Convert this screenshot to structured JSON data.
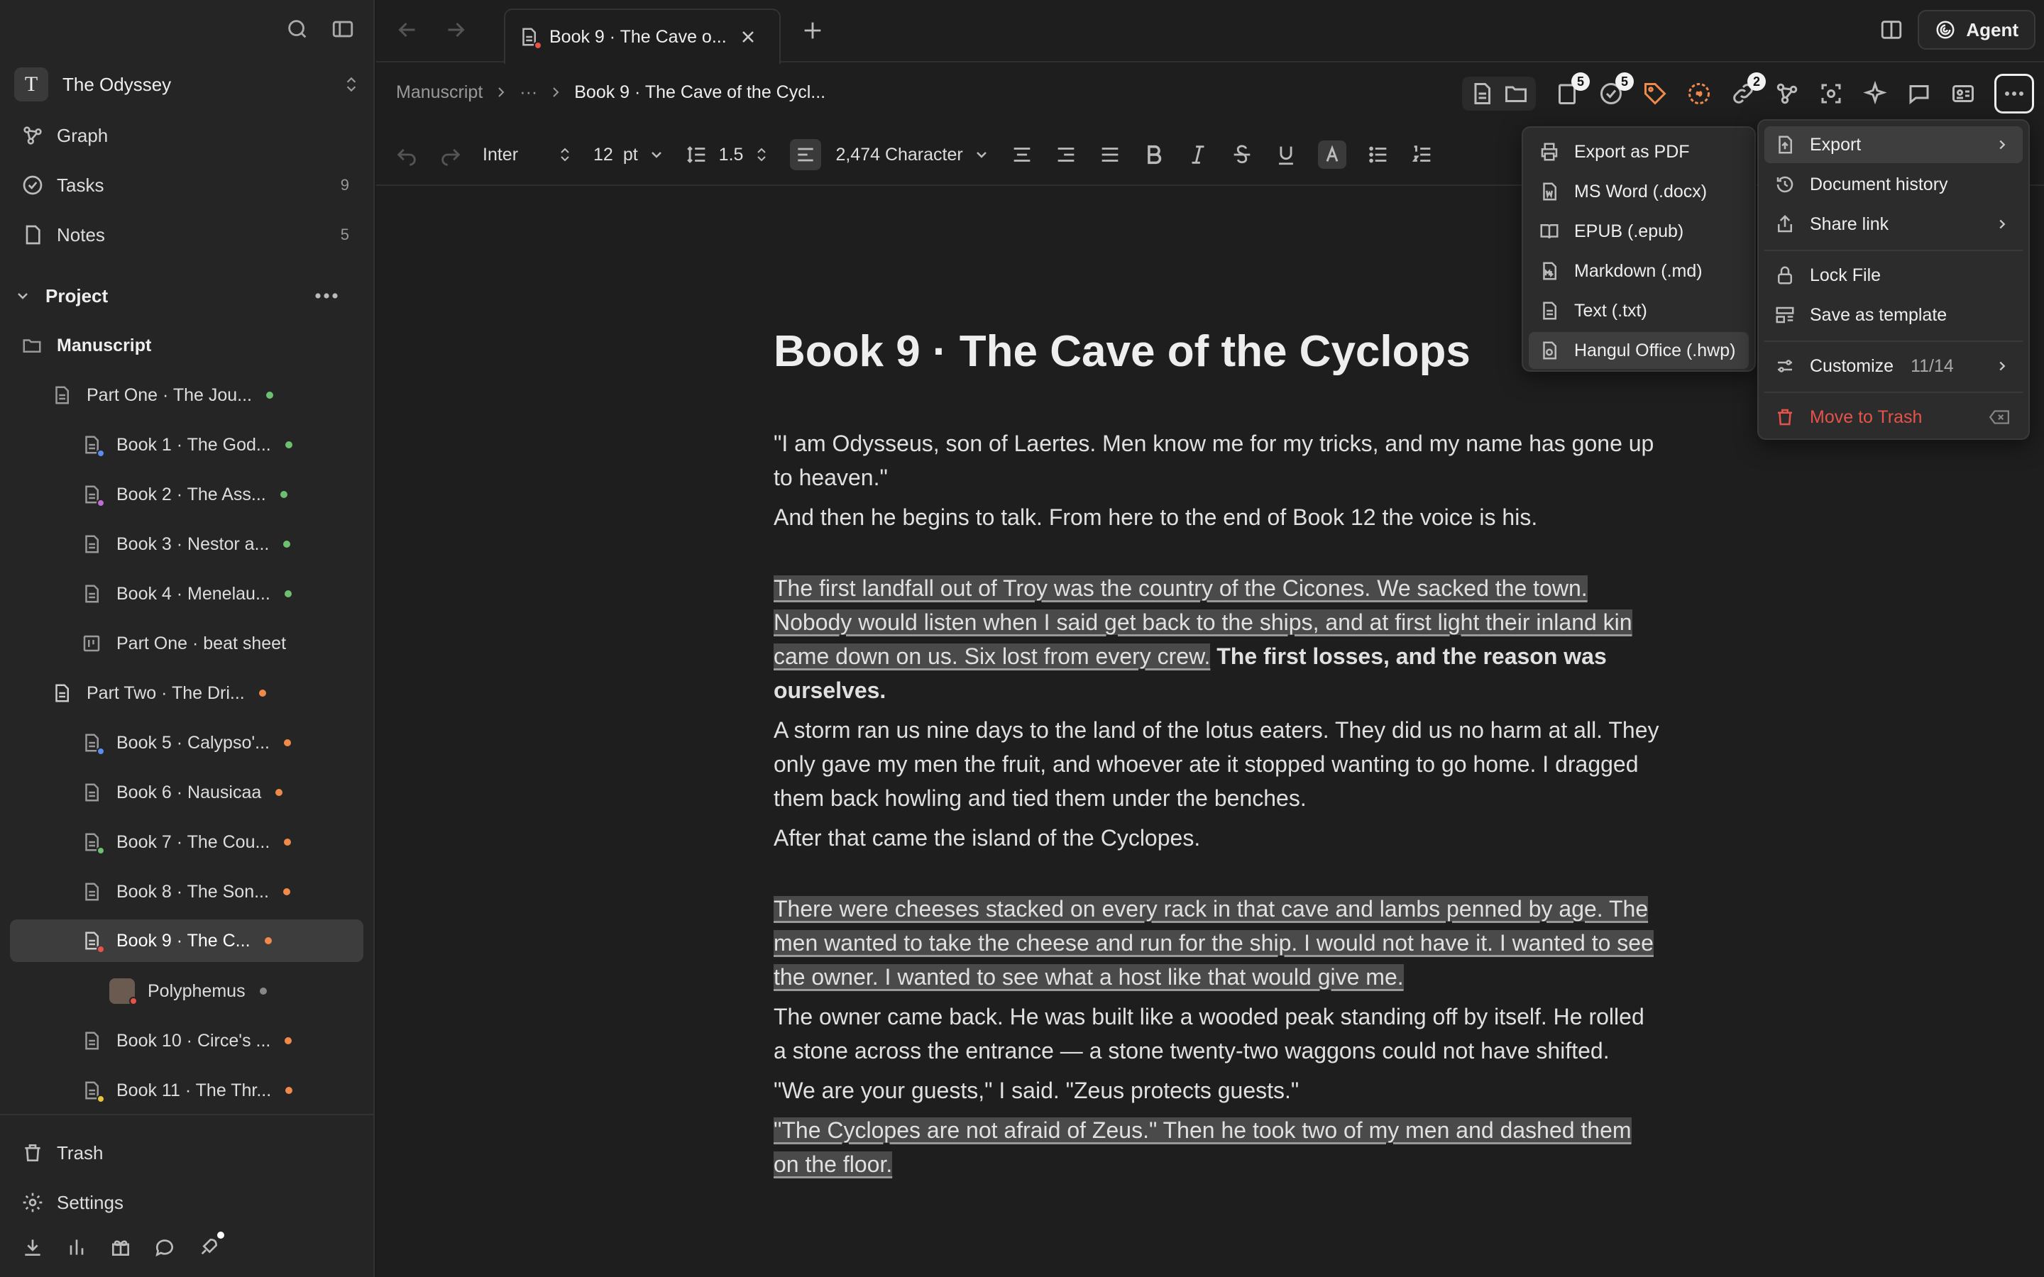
{
  "workspace": {
    "initial": "T",
    "name": "The Odyssey"
  },
  "nav": [
    {
      "label": "Graph",
      "icon": "graph-icon",
      "count": ""
    },
    {
      "label": "Tasks",
      "icon": "tasks-icon",
      "count": "9"
    },
    {
      "label": "Notes",
      "icon": "notes-icon",
      "count": "5"
    }
  ],
  "project": {
    "label": "Project"
  },
  "tree": {
    "manuscript": "Manuscript",
    "items": [
      {
        "label": "Part One · The Jou..."
      },
      {
        "label": "Book 1 · The God..."
      },
      {
        "label": "Book 2 · The Ass..."
      },
      {
        "label": "Book 3 · Nestor a..."
      },
      {
        "label": "Book 4 · Menelau..."
      },
      {
        "label": "Part One · beat sheet"
      },
      {
        "label": "Part Two · The Dri..."
      },
      {
        "label": "Book 5 · Calypso'..."
      },
      {
        "label": "Book 6 · Nausicaa"
      },
      {
        "label": "Book 7 · The Cou..."
      },
      {
        "label": "Book 8 · The Son..."
      },
      {
        "label": "Book 9 · The C..."
      },
      {
        "label": "Polyphemus"
      },
      {
        "label": "Book 10 · Circe's ..."
      },
      {
        "label": "Book 11 · The Thr..."
      }
    ]
  },
  "bottom": {
    "trash": "Trash",
    "settings": "Settings"
  },
  "tab": {
    "title": "Book 9 · The Cave o..."
  },
  "agent": {
    "label": "Agent"
  },
  "breadcrumb": {
    "root": "Manuscript",
    "ellipsis": "···",
    "current": "Book 9 · The Cave of the Cycl..."
  },
  "badges": {
    "pages": "5",
    "tasks": "5",
    "links": "2"
  },
  "format": {
    "font": "Inter",
    "size": "12",
    "unit": "pt",
    "line_height": "1.5",
    "char_count": "2,474 Character"
  },
  "document": {
    "title": "Book 9 · The Cave of the Cyclops",
    "p1": "\"I am Odysseus, son of Laertes. Men know me for my tricks, and my name has gone up to heaven.\"",
    "p2": "And then he begins to talk. From here to the end of Book 12 the voice is his.",
    "p3_hl": "The first landfall out of Troy was the country of the Cicones. We sacked the town. Nobody would listen when I said get back to the ships, and at first light their inland kin came down on us. Six lost from every crew.",
    "p3_bold": "The first losses, and the reason was ourselves.",
    "p4": "A storm ran us nine days to the land of the lotus eaters. They did us no harm at all. They only gave my men the fruit, and whoever ate it stopped wanting to go home. I dragged them back howling and tied them under the benches.",
    "p5": "After that came the island of the Cyclopes.",
    "p6_hl": "There were cheeses stacked on every rack in that cave and lambs penned by age. The men wanted to take the cheese and run for the ship. I would not have it. I wanted to see the owner. I wanted to see what a host like that would give me.",
    "p7": "The owner came back. He was built like a wooded peak standing off by itself. He rolled a stone across the entrance — a stone twenty-two waggons could not have shifted.",
    "p8": "\"We are your guests,\" I said. \"Zeus protects guests.\"",
    "p9_hl": "\"The Cyclopes are not afraid of Zeus.\" Then he took two of my men and dashed them on the floor."
  },
  "export_menu": [
    {
      "label": "Export as PDF",
      "icon": "printer-icon"
    },
    {
      "label": "MS Word (.docx)",
      "icon": "word-file-icon"
    },
    {
      "label": "EPUB (.epub)",
      "icon": "book-icon"
    },
    {
      "label": "Markdown (.md)",
      "icon": "markdown-file-icon"
    },
    {
      "label": "Text (.txt)",
      "icon": "text-file-icon"
    },
    {
      "label": "Hangul Office (.hwp)",
      "icon": "hwp-file-icon"
    }
  ],
  "more_menu": {
    "export": "Export",
    "history": "Document history",
    "share": "Share link",
    "lock": "Lock File",
    "template": "Save as template",
    "customize": "Customize",
    "customize_count": "11/14",
    "trash": "Move to Trash"
  },
  "colors": {
    "green": "#6cc070",
    "orange": "#f08a4b",
    "blue": "#5b8def",
    "purple": "#c06bd6",
    "red": "#e5534b",
    "yellow": "#e8c33a",
    "gray": "#888888"
  }
}
